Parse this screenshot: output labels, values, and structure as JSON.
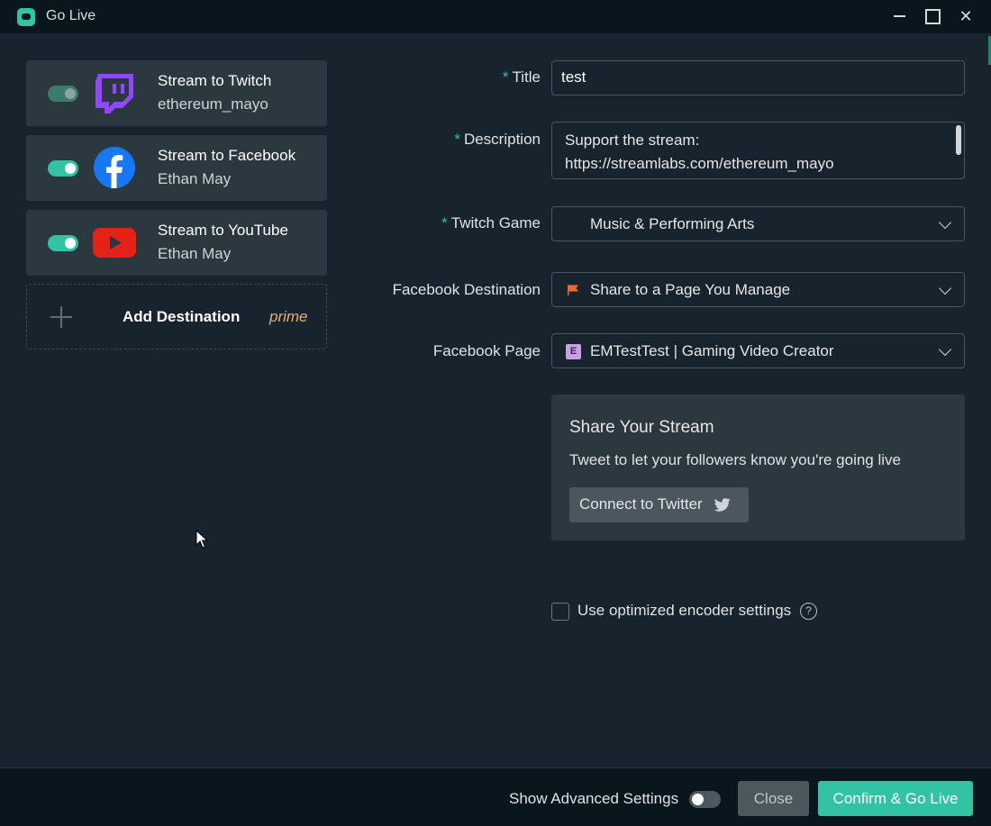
{
  "window": {
    "title": "Go Live"
  },
  "colors": {
    "accent": "#31c3a2",
    "background": "#17242d",
    "card": "#2b383f",
    "prime": "#e3b173"
  },
  "destinations": [
    {
      "title": "Stream to Twitch",
      "account": "ethereum_mayo",
      "enabled": true,
      "icon": "twitch-icon"
    },
    {
      "title": "Stream to Facebook",
      "account": "Ethan May",
      "enabled": true,
      "icon": "facebook-icon"
    },
    {
      "title": "Stream to YouTube",
      "account": "Ethan May",
      "enabled": true,
      "icon": "youtube-icon"
    }
  ],
  "add_destination": {
    "label": "Add Destination",
    "badge": "prime"
  },
  "form": {
    "title_label": "Title",
    "title_value": "test",
    "description_label": "Description",
    "description_line1": "Support the stream:",
    "description_line2": "https://streamlabs.com/ethereum_mayo",
    "game_label": "Twitch Game",
    "game_value": "Music & Performing Arts",
    "fb_dest_label": "Facebook Destination",
    "fb_dest_value": "Share to a Page You Manage",
    "fb_page_label": "Facebook Page",
    "fb_page_badge": "E",
    "fb_page_value": "EMTestTest | Gaming Video Creator",
    "required_mark": "*"
  },
  "share": {
    "title": "Share Your Stream",
    "text": "Tweet to let your followers know you're going live",
    "button": "Connect to Twitter"
  },
  "encoder": {
    "label": "Use optimized encoder settings",
    "help": "?",
    "checked": false
  },
  "footer": {
    "advanced_label": "Show Advanced Settings",
    "advanced_on": false,
    "close": "Close",
    "confirm": "Confirm & Go Live"
  }
}
